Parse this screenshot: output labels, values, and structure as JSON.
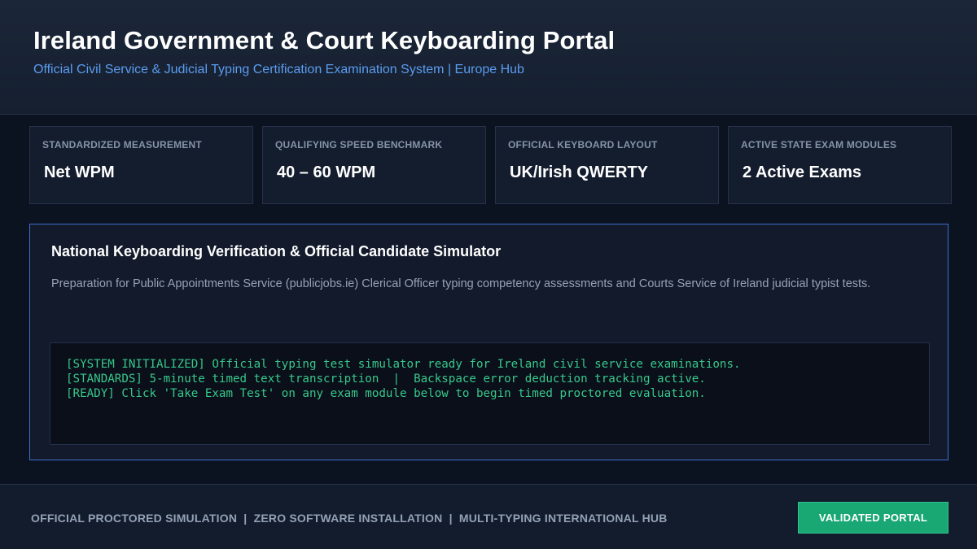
{
  "header": {
    "title": "Ireland Government & Court Keyboarding Portal",
    "subtitle": "Official Civil Service & Judicial Typing Certification Examination System  |  Europe Hub"
  },
  "stats": [
    {
      "label": "STANDARDIZED MEASUREMENT",
      "value": "Net WPM"
    },
    {
      "label": "QUALIFYING SPEED BENCHMARK",
      "value": "40 – 60 WPM"
    },
    {
      "label": "OFFICIAL KEYBOARD LAYOUT",
      "value": "UK/Irish QWERTY"
    },
    {
      "label": "ACTIVE STATE EXAM MODULES",
      "value": "2 Active Exams"
    }
  ],
  "panel": {
    "title": "National Keyboarding Verification & Official Candidate Simulator",
    "description": "Preparation for Public Appointments Service (publicjobs.ie) Clerical Officer typing competency assessments and Courts Service of Ireland judicial typist tests.",
    "console_lines": [
      "[SYSTEM INITIALIZED] Official typing test simulator ready for Ireland civil service examinations.",
      "[STANDARDS] 5-minute timed text transcription  |  Backspace error deduction tracking active.",
      "[READY] Click 'Take Exam Test' on any exam module below to begin timed proctored evaluation."
    ]
  },
  "footer": {
    "tagline": "OFFICIAL PROCTORED SIMULATION  |  ZERO SOFTWARE INSTALLATION  |  MULTI-TYPING INTERNATIONAL HUB",
    "badge": "VALIDATED PORTAL"
  },
  "colors": {
    "background": "#0b1220",
    "accent_blue": "#5b9cf0",
    "console_green": "#38c88a",
    "badge_green": "#19a774"
  }
}
